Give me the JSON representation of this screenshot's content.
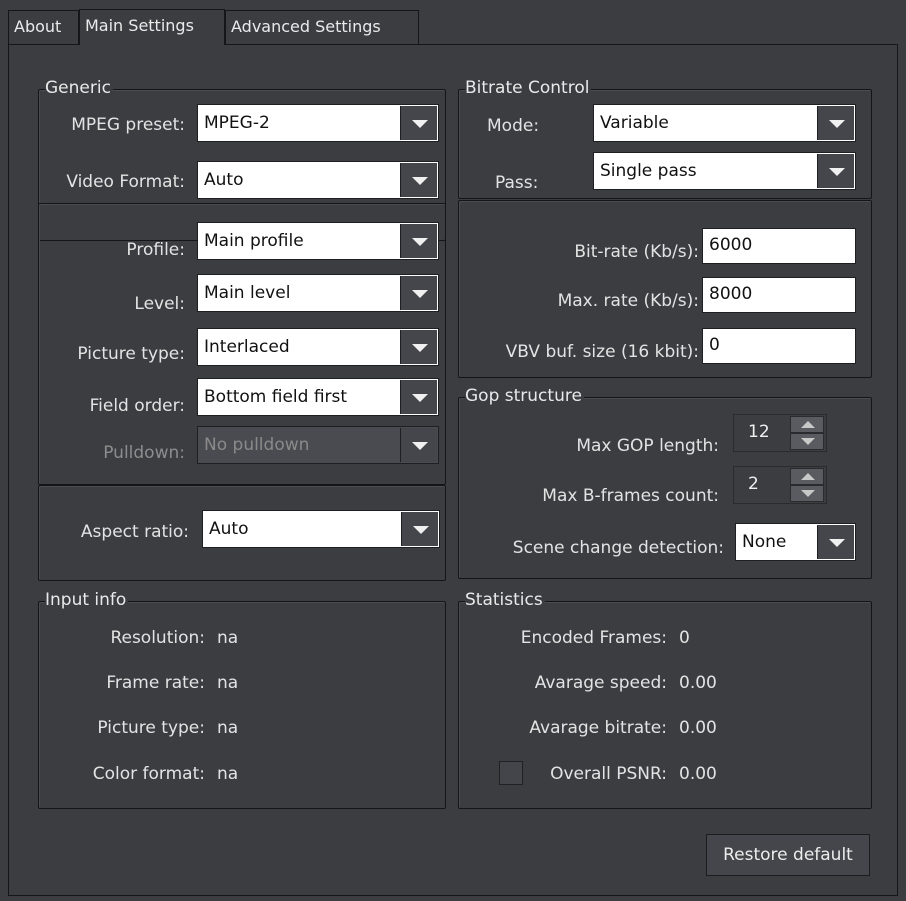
{
  "tabs": [
    {
      "label": "About"
    },
    {
      "label": "Main Settings"
    },
    {
      "label": "Advanced Settings"
    }
  ],
  "generic": {
    "title": "Generic",
    "mpeg_preset_label": "MPEG preset:",
    "mpeg_preset_value": "MPEG-2",
    "video_format_label": "Video Format:",
    "video_format_value": "Auto"
  },
  "profile_group": {
    "profile_label": "Profile:",
    "profile_value": "Main profile",
    "level_label": "Level:",
    "level_value": "Main level",
    "picture_type_label": "Picture type:",
    "picture_type_value": "Interlaced",
    "field_order_label": "Field order:",
    "field_order_value": "Bottom field first",
    "pulldown_label": "Pulldown:",
    "pulldown_value": "No pulldown"
  },
  "aspect": {
    "label": "Aspect ratio:",
    "value": "Auto"
  },
  "input_info": {
    "title": "Input info",
    "resolution_label": "Resolution:",
    "resolution_value": "na",
    "frame_rate_label": "Frame rate:",
    "frame_rate_value": "na",
    "picture_type_label": "Picture type:",
    "picture_type_value": "na",
    "color_format_label": "Color format:",
    "color_format_value": "na"
  },
  "bitrate_control": {
    "title": "Bitrate Control",
    "mode_label": "Mode:",
    "mode_value": "Variable",
    "pass_label": "Pass:",
    "pass_value": "Single pass",
    "bitrate_label": "Bit-rate (Kb/s):",
    "bitrate_value": "6000",
    "maxrate_label": "Max. rate (Kb/s):",
    "maxrate_value": "8000",
    "vbv_label": "VBV buf. size (16 kbit):",
    "vbv_value": "0"
  },
  "gop": {
    "title": "Gop structure",
    "max_gop_label": "Max GOP length:",
    "max_gop_value": "12",
    "max_b_label": "Max B-frames count:",
    "max_b_value": "2",
    "scene_label": "Scene change detection:",
    "scene_value": "None"
  },
  "statistics": {
    "title": "Statistics",
    "encoded_label": "Encoded Frames:",
    "encoded_value": "0",
    "speed_label": "Avarage speed:",
    "speed_value": "0.00",
    "bitrate_label": "Avarage bitrate:",
    "bitrate_value": "0.00",
    "psnr_label": "Overall PSNR:",
    "psnr_value": "0.00"
  },
  "restore_button": "Restore default",
  "icons": {
    "combo_arrow": "chevron-down-icon",
    "spin_up": "spin-up-icon",
    "spin_down": "spin-down-icon"
  },
  "colors": {
    "background": "#3c3d41",
    "field_background": "#ffffff",
    "border": "#15161a"
  }
}
